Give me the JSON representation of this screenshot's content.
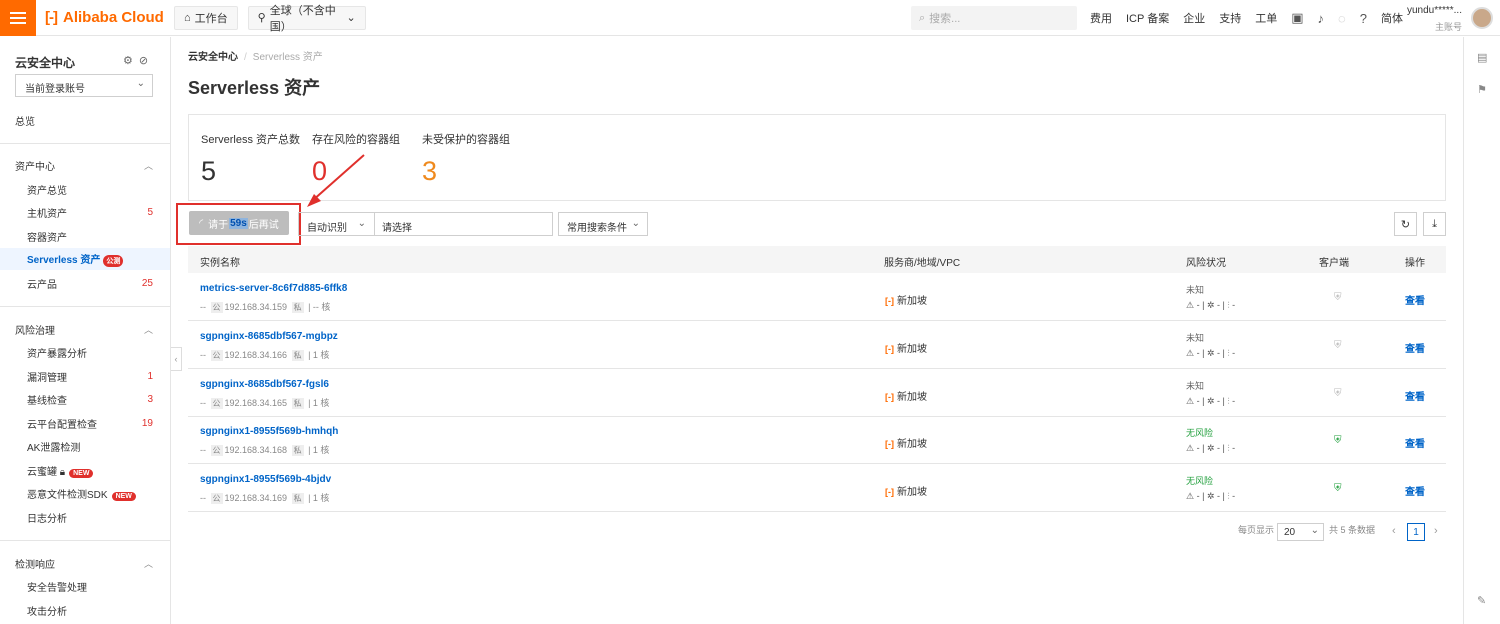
{
  "topbar": {
    "brand": "Alibaba Cloud",
    "workbench": "工作台",
    "region": "全球（不含中国）",
    "search_placeholder": "搜索...",
    "nav": [
      "费用",
      "ICP 备案",
      "企业",
      "支持",
      "工单"
    ],
    "lang": "简体",
    "user_name": "yundu*****...",
    "user_role": "主账号"
  },
  "sidebar": {
    "title": "云安全中心",
    "account_select": "当前登录账号",
    "overview": "总览",
    "groups": [
      {
        "label": "资产中心",
        "items": [
          {
            "label": "资产总览",
            "count": ""
          },
          {
            "label": "主机资产",
            "count": "5"
          },
          {
            "label": "容器资产",
            "count": ""
          },
          {
            "label": "Serverless 资产",
            "count": "",
            "badge": "公测"
          },
          {
            "label": "云产品",
            "count": "25"
          }
        ]
      },
      {
        "label": "风险治理",
        "items": [
          {
            "label": "资产暴露分析",
            "count": ""
          },
          {
            "label": "漏洞管理",
            "count": "1"
          },
          {
            "label": "基线检查",
            "count": "3"
          },
          {
            "label": "云平台配置检查",
            "count": "19"
          },
          {
            "label": "AK泄露检测",
            "count": ""
          },
          {
            "label": "云蜜罐",
            "count": "",
            "badge": "NEW"
          },
          {
            "label": "恶意文件检测SDK",
            "count": "",
            "badge": "NEW"
          },
          {
            "label": "日志分析",
            "count": ""
          }
        ]
      },
      {
        "label": "检测响应",
        "items": [
          {
            "label": "安全告警处理",
            "count": ""
          },
          {
            "label": "攻击分析",
            "count": ""
          }
        ]
      }
    ]
  },
  "breadcrumb": {
    "root": "云安全中心",
    "current": "Serverless 资产"
  },
  "page_title": "Serverless 资产",
  "stats": [
    {
      "label": "Serverless 资产总数",
      "value": "5",
      "color": "#333333"
    },
    {
      "label": "存在风险的容器组",
      "value": "0",
      "color": "#e0302c"
    },
    {
      "label": "未受保护的容器组",
      "value": "3",
      "color": "#ef8a1e"
    }
  ],
  "toolbar": {
    "retry_prefix": "请于",
    "retry_countdown": "59s",
    "retry_suffix": "后再试",
    "identify": "自动识别",
    "choose_placeholder": "请选择",
    "common_search": "常用搜索条件"
  },
  "table": {
    "headers": {
      "name": "实例名称",
      "provider": "服务商/地域/VPC",
      "risk": "风险状况",
      "client": "客户端",
      "action": "操作"
    },
    "rows": [
      {
        "name": "metrics-server-8c6f7d885-6ffk8",
        "ip": "192.168.34.159",
        "cores": "-- 核",
        "region": "新加坡",
        "risk": "未知",
        "ok": false,
        "view": "查看"
      },
      {
        "name": "sgpnginx-8685dbf567-mgbpz",
        "ip": "192.168.34.166",
        "cores": "1 核",
        "region": "新加坡",
        "risk": "未知",
        "ok": false,
        "view": "查看"
      },
      {
        "name": "sgpnginx-8685dbf567-fgsl6",
        "ip": "192.168.34.165",
        "cores": "1 核",
        "region": "新加坡",
        "risk": "未知",
        "ok": false,
        "view": "查看"
      },
      {
        "name": "sgpnginx1-8955f569b-hmhqh",
        "ip": "192.168.34.168",
        "cores": "1 核",
        "region": "新加坡",
        "risk": "无风险",
        "ok": true,
        "view": "查看"
      },
      {
        "name": "sgpnginx1-8955f569b-4bjdv",
        "ip": "192.168.34.169",
        "cores": "1 核",
        "region": "新加坡",
        "risk": "无风险",
        "ok": true,
        "view": "查看"
      }
    ]
  },
  "pagination": {
    "per_page_label": "每页显示",
    "per_page": "20",
    "total": "共 5 条数据",
    "current": "1"
  }
}
